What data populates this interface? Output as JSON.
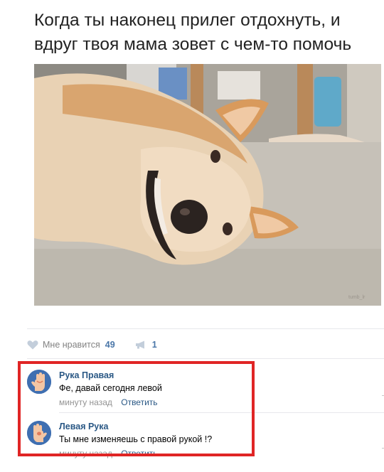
{
  "meme": {
    "caption_line1": "Когда ты наконец прилег отдохнуть, и",
    "caption_line2": "вдруг твоя мама зовет с чем-то помочь"
  },
  "actions": {
    "like_label": "Мне нравится",
    "like_count": "49",
    "share_count": "1"
  },
  "comments": [
    {
      "author": "Рука Правая",
      "text": "Фе, давай сегодня левой",
      "time": "минуту назад",
      "reply_label": "Ответить"
    },
    {
      "author": "Левая Рука",
      "text": "Ты мне изменяешь с правой рукой !?",
      "time": "минуту назад",
      "reply_label": "Ответить"
    }
  ],
  "colors": {
    "link": "#2a5885",
    "count": "#4a76a8",
    "highlight": "#e02525"
  }
}
